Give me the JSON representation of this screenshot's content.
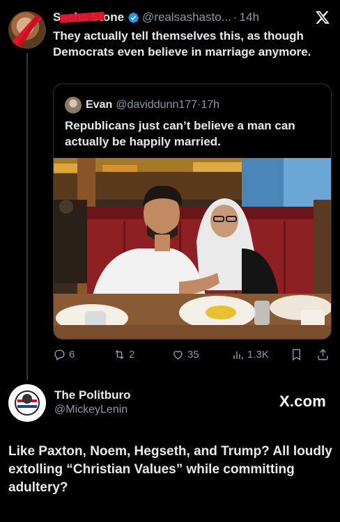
{
  "post1": {
    "display_name": "Sasha Stone",
    "handle": "@realsashasto...",
    "time": "14h",
    "text": "They actually tell themselves this, as though Democrats even believe in marriage anymore."
  },
  "quoted": {
    "display_name": "Evan",
    "handle": "@daviddunn177",
    "time": "17h",
    "text": "Republicans just can’t believe a man can actually be happily married."
  },
  "actions": {
    "replies": "6",
    "reposts": "2",
    "likes": "35",
    "views": "1.3K"
  },
  "post2": {
    "display_name": "The Politburo",
    "handle": "@MickeyLenin",
    "source": "X.com",
    "text": "Like Paxton, Noem, Hegseth, and Trump? All loudly extolling “Christian Values” while committing adultery?"
  },
  "colors": {
    "background": "#000000",
    "text": "#e7e9ea",
    "muted": "#8b98a5",
    "verified": "#1d9bf0",
    "border": "#2f3336"
  },
  "icons": [
    "verified-badge-icon",
    "x-logo-icon",
    "reply-icon",
    "repost-icon",
    "like-icon",
    "views-icon",
    "bookmark-icon",
    "share-icon"
  ]
}
